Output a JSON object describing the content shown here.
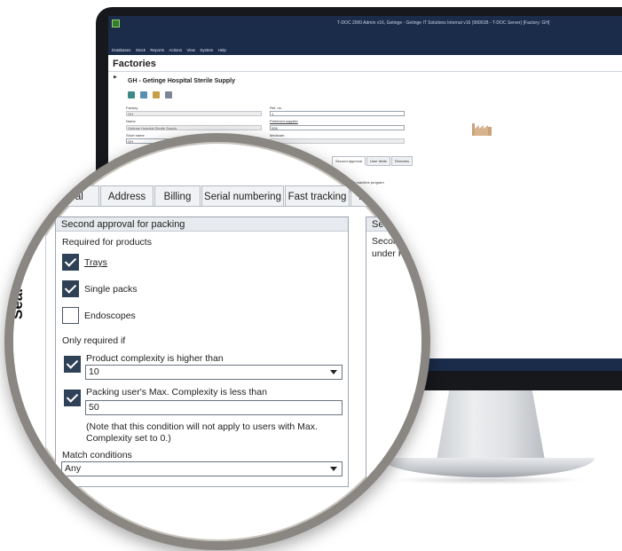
{
  "window": {
    "title": "T-DOC 2000 Admin v16, Getinge - Getinge IT Solutions Internal v16 (99001B - T-DOC Server) [Factory: GH]"
  },
  "menu": [
    "Databases",
    "Stock",
    "Reports",
    "Actions",
    "View",
    "System",
    "Help"
  ],
  "page": {
    "title": "Factories"
  },
  "factory": {
    "title": "GH - Getinge Hospital Sterile Supply",
    "fields": {
      "factory_label": "Factory",
      "factory_value": "GH",
      "name_label": "Name",
      "name_value": "Getinge Hospital Sterile Supply",
      "short_name_label": "Short name",
      "short_name_value": "GH",
      "ref_no_label": "Ref. no.",
      "ref_no_value": "1",
      "preferred_supplier_label": "Preferred supplier",
      "preferred_supplier_value": "006",
      "medicare_label": "Medicare"
    },
    "small_tabs": [
      "Second approval",
      "User fields",
      "Remarks"
    ],
    "small_hint": "ach machine program"
  },
  "sidebar": {
    "search_label": "Search"
  },
  "tabs": [
    {
      "label": "neral"
    },
    {
      "label": "Address"
    },
    {
      "label": "Billing"
    },
    {
      "label": "Serial numbering"
    },
    {
      "label": "Fast tracking"
    },
    {
      "label": "E"
    }
  ],
  "second_approval": {
    "header": "Second approval for packing",
    "required_for_products_label": "Required for products",
    "trays": {
      "label": "Trays",
      "checked": true
    },
    "single_packs": {
      "label": "Single packs",
      "checked": true
    },
    "endoscopes": {
      "label": "Endoscopes",
      "checked": false
    },
    "only_required_if_label": "Only required if",
    "product_complexity": {
      "label": "Product complexity is higher than",
      "checked": true,
      "value": "10"
    },
    "packing_user_complexity": {
      "label": "Packing user's Max. Complexity is less than",
      "checked": true,
      "value": "50"
    },
    "note_line1": "(Note that this condition will not apply to users with Max.",
    "note_line2": "Complexity set to 0.)",
    "match_conditions_label": "Match conditions",
    "match_conditions_value": "Any"
  },
  "side_group": {
    "header": "Seco",
    "text_line1": "Second",
    "text_line2": "under Pr"
  },
  "colors": {
    "titlebar": "#1b2b4a",
    "checkbox_checked": "#2f4157",
    "lens_rim": "#8a8782"
  }
}
